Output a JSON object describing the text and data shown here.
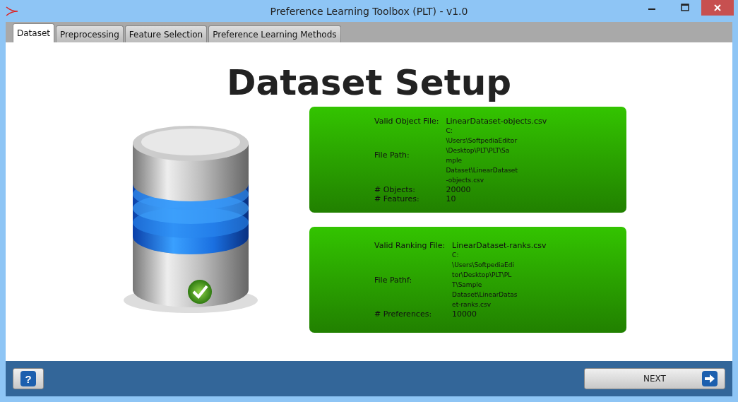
{
  "window": {
    "title": "Preference Learning Toolbox (PLT) - v1.0"
  },
  "tabs": [
    {
      "label": "Dataset",
      "selected": true
    },
    {
      "label": "Preprocessing",
      "selected": false
    },
    {
      "label": "Feature Selection",
      "selected": false
    },
    {
      "label": "Preference Learning Methods",
      "selected": false
    }
  ],
  "heading": "Dataset Setup",
  "panels": [
    {
      "fields": [
        {
          "label": "Valid Object File:",
          "value_lines": [
            "LinearDataset-objects.csv"
          ],
          "kind": "main"
        },
        {
          "label": "File Path:",
          "value_lines": [
            "C:",
            "\\Users\\SoftpediaEditor",
            "\\Desktop\\PLT\\PLT\\Sa",
            "mple",
            "Dataset\\LinearDataset",
            "-objects.csv"
          ],
          "kind": "path"
        },
        {
          "label": "# Objects:",
          "value_lines": [
            "20000"
          ],
          "kind": "main"
        },
        {
          "label": "# Features:",
          "value_lines": [
            "10"
          ],
          "kind": "main"
        }
      ]
    },
    {
      "fields": [
        {
          "label": "Valid Ranking File:",
          "value_lines": [
            "LinearDataset-ranks.csv"
          ],
          "kind": "main"
        },
        {
          "label": "File Pathf:",
          "value_lines": [
            "C:",
            "\\Users\\SoftpediaEdi",
            "tor\\Desktop\\PLT\\PL",
            "T\\Sample",
            "Dataset\\LinearDatas",
            "et-ranks.csv"
          ],
          "kind": "path"
        },
        {
          "label": "# Preferences:",
          "value_lines": [
            "10000"
          ],
          "kind": "main"
        }
      ]
    }
  ],
  "footer": {
    "next_button": "NEXT",
    "help_button": "?"
  }
}
